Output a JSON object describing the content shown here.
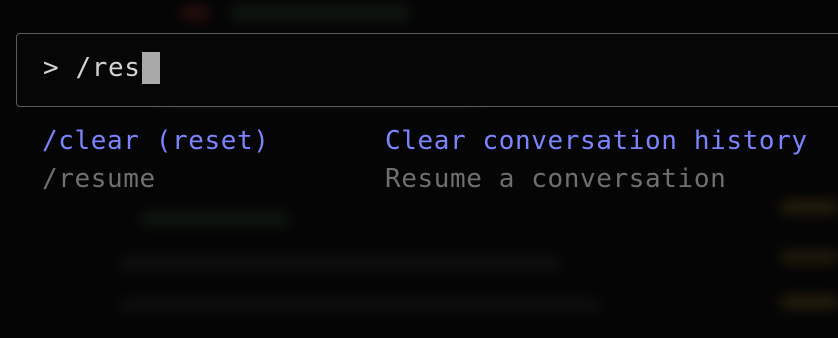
{
  "prompt": {
    "symbol": ">",
    "input_value": "/res"
  },
  "suggestions": [
    {
      "command": "/clear (reset)",
      "description": "Clear conversation history",
      "selected": true
    },
    {
      "command": "/resume",
      "description": "Resume a conversation",
      "selected": false
    }
  ],
  "colors": {
    "selected": "#7b83ff",
    "unselected": "#6f6f6f",
    "input_text": "#d4d4d4",
    "border": "#5b5b5b",
    "background": "#050505"
  }
}
